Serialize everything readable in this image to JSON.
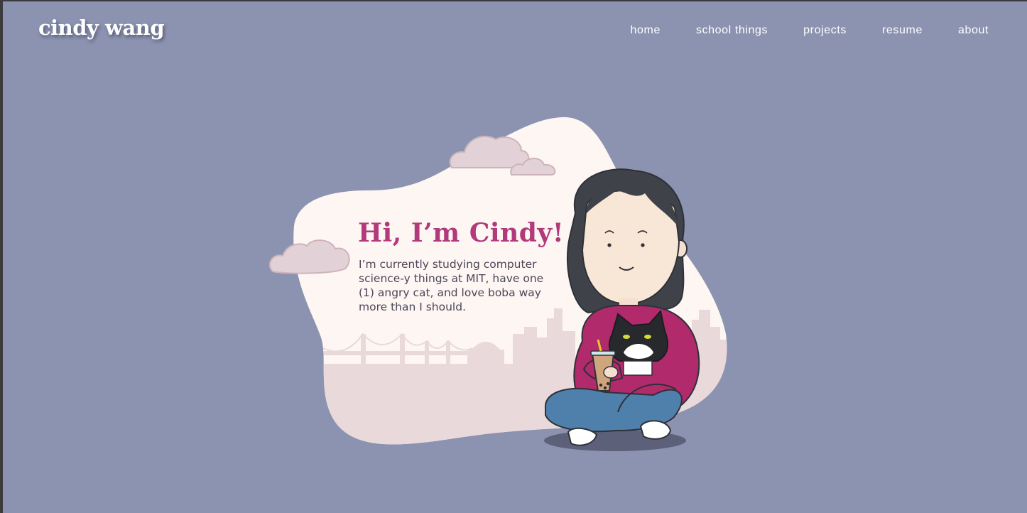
{
  "header": {
    "logo": "cindy wang",
    "nav": [
      {
        "label": "home"
      },
      {
        "label": "school things"
      },
      {
        "label": "projects"
      },
      {
        "label": "resume"
      },
      {
        "label": "about"
      }
    ]
  },
  "hero": {
    "title": "Hi, I’m Cindy!",
    "description": "I’m currently studying computer science-y things at MIT, have one (1) angry cat, and love boba way more than I should."
  },
  "colors": {
    "background": "#8c93b0",
    "title_accent": "#b23a7a",
    "blob": "#fdf6f3",
    "skyline": "#ead9db",
    "sweater": "#b02a6c",
    "jeans": "#4f7fab",
    "hair": "#3f4349"
  },
  "icons": {
    "illustration": "girl-holding-cat-and-boba-illustration",
    "clouds": "cloud-icon",
    "skyline": "city-skyline-illustration"
  }
}
